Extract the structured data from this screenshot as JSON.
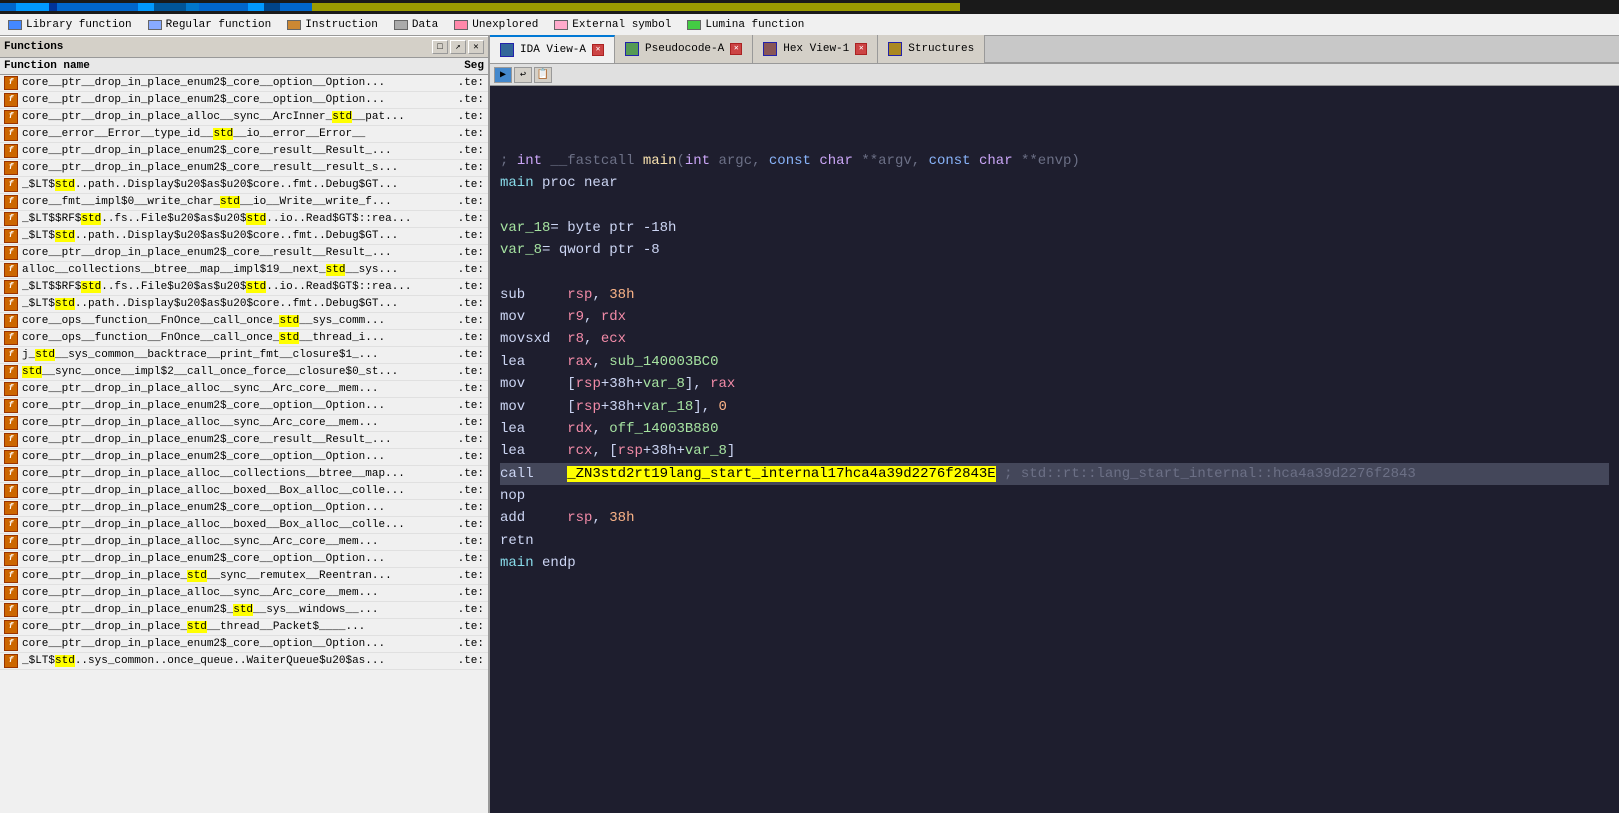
{
  "topbar": {
    "segments": [
      {
        "color": "#0078d4",
        "width": "3%"
      },
      {
        "color": "#00aaff",
        "width": "8%"
      },
      {
        "color": "#0055cc",
        "width": "2%"
      },
      {
        "color": "#0078d4",
        "width": "1%"
      },
      {
        "color": "#00aaff",
        "width": "5%"
      },
      {
        "color": "#0055cc",
        "width": "1%"
      },
      {
        "color": "#0078d4",
        "width": "3%"
      },
      {
        "color": "#1a1a1a",
        "width": "77%"
      }
    ]
  },
  "legend": {
    "items": [
      {
        "label": "Library function",
        "color": "#4488ff"
      },
      {
        "label": "Regular function",
        "color": "#88aaff"
      },
      {
        "label": "Instruction",
        "color": "#cc8833"
      },
      {
        "label": "Data",
        "color": "#aaaaaa"
      },
      {
        "label": "Unexplored",
        "color": "#ff88aa"
      },
      {
        "label": "External symbol",
        "color": "#ffaacc"
      },
      {
        "label": "Lumina function",
        "color": "#44cc44"
      }
    ]
  },
  "functions_panel": {
    "title": "Functions",
    "columns": {
      "name": "Function name",
      "seg": "Seg"
    },
    "items": [
      {
        "name": "core__ptr__drop_in_place_enum2$_core__option__Option...",
        "seg": ".te:"
      },
      {
        "name": "core__ptr__drop_in_place_enum2$_core__option__Option...",
        "seg": ".te:"
      },
      {
        "name": "core__ptr__drop_in_place_alloc__sync__ArcInner_std__pat...",
        "seg": ".te:"
      },
      {
        "name": "core__error__Error__type_id__std__io__error__Error__",
        "seg": ".te:"
      },
      {
        "name": "core__ptr__drop_in_place_enum2$_core__result__Result_...",
        "seg": ".te:"
      },
      {
        "name": "core__ptr__drop_in_place_enum2$_core__result__result_s...",
        "seg": ".te:"
      },
      {
        "name": "_$LT$std..path..Display$u20$as$u20$core..fmt..Debug$GT...",
        "seg": ".te:"
      },
      {
        "name": "core__fmt__impl$0__write_char_std__io__Write__write_f...",
        "seg": ".te:"
      },
      {
        "name": "_$LT$$RF$std..fs..File$u20$as$u20$std..io..Read$GT$::rea...",
        "seg": ".te:"
      },
      {
        "name": "_$LT$std..path..Display$u20$as$u20$core..fmt..Debug$GT...",
        "seg": ".te:"
      },
      {
        "name": "core__ptr__drop_in_place_enum2$_core__result__Result_...",
        "seg": ".te:"
      },
      {
        "name": "alloc__collections__btree__map__impl$19__next_std__sys...",
        "seg": ".te:"
      },
      {
        "name": "_$LT$$RF$std..fs..File$u20$as$u20$std..io..Read$GT$::rea...",
        "seg": ".te:"
      },
      {
        "name": "_$LT$std..path..Display$u20$as$u20$core..fmt..Debug$GT...",
        "seg": ".te:"
      },
      {
        "name": "core__ops__function__FnOnce__call_once_std__sys_comm...",
        "seg": ".te:"
      },
      {
        "name": "core__ops__function__FnOnce__call_once_std__thread_i...",
        "seg": ".te:"
      },
      {
        "name": "j_std__sys_common__backtrace__print_fmt__closure$1_...",
        "seg": ".te:"
      },
      {
        "name": "std__sync__once__impl$2__call_once_force__closure$0_st...",
        "seg": ".te:"
      },
      {
        "name": "core__ptr__drop_in_place_alloc__sync__Arc_core__mem...",
        "seg": ".te:"
      },
      {
        "name": "core__ptr__drop_in_place_enum2$_core__option__Option...",
        "seg": ".te:"
      },
      {
        "name": "core__ptr__drop_in_place_alloc__sync__Arc_core__mem...",
        "seg": ".te:"
      },
      {
        "name": "core__ptr__drop_in_place_enum2$_core__result__Result_...",
        "seg": ".te:"
      },
      {
        "name": "core__ptr__drop_in_place_enum2$_core__option__Option...",
        "seg": ".te:"
      },
      {
        "name": "core__ptr__drop_in_place_alloc__collections__btree__map...",
        "seg": ".te:"
      },
      {
        "name": "core__ptr__drop_in_place_alloc__boxed__Box_alloc__colle...",
        "seg": ".te:"
      },
      {
        "name": "core__ptr__drop_in_place_enum2$_core__option__Option...",
        "seg": ".te:"
      },
      {
        "name": "core__ptr__drop_in_place_alloc__boxed__Box_alloc__colle...",
        "seg": ".te:"
      },
      {
        "name": "core__ptr__drop_in_place_alloc__sync__Arc_core__mem...",
        "seg": ".te:"
      },
      {
        "name": "core__ptr__drop_in_place_enum2$_core__option__Option...",
        "seg": ".te:"
      },
      {
        "name": "core__ptr__drop_in_place_std__sync__remutex__Reentran...",
        "seg": ".te:"
      },
      {
        "name": "core__ptr__drop_in_place_alloc__sync__Arc_core__mem...",
        "seg": ".te:"
      },
      {
        "name": "core__ptr__drop_in_place_enum2$_std__sys__windows__...",
        "seg": ".te:"
      },
      {
        "name": "core__ptr__drop_in_place_std__thread__Packet$____...",
        "seg": ".te:"
      },
      {
        "name": "core__ptr__drop_in_place_enum2$_core__option__Option...",
        "seg": ".te:"
      },
      {
        "name": "_$LT$std..sys_common..once_queue..WaiterQueue$u20$as...",
        "seg": ".te:"
      }
    ]
  },
  "tabs": [
    {
      "label": "IDA View-A",
      "active": true,
      "closable": true
    },
    {
      "label": "Pseudocode-A",
      "active": false,
      "closable": true
    },
    {
      "label": "Hex View-1",
      "active": false,
      "closable": true
    },
    {
      "label": "Structures",
      "active": false,
      "closable": false
    }
  ],
  "code": {
    "comment_line": "; int __fastcall main(int argc, const char **argv, const char **envp)",
    "lines": [
      {
        "text": "",
        "type": "empty"
      },
      {
        "text": "",
        "type": "empty"
      },
      {
        "text": "; int __fastcall main(int argc, const char **argv, const char **envp)",
        "type": "comment"
      },
      {
        "text": "main proc near",
        "type": "label"
      },
      {
        "text": "",
        "type": "empty"
      },
      {
        "text": "var_18= byte ptr -18h",
        "type": "vardef"
      },
      {
        "text": "var_8= qword ptr -8",
        "type": "vardef"
      },
      {
        "text": "",
        "type": "empty"
      },
      {
        "text": "sub     rsp, 38h",
        "type": "instruction"
      },
      {
        "text": "mov     r9, rdx",
        "type": "instruction"
      },
      {
        "text": "movsxd  r8, ecx",
        "type": "instruction"
      },
      {
        "text": "lea     rax, sub_140003BC0",
        "type": "instruction"
      },
      {
        "text": "mov     [rsp+38h+var_8], rax",
        "type": "instruction"
      },
      {
        "text": "mov     [rsp+38h+var_18], 0",
        "type": "instruction"
      },
      {
        "text": "lea     rdx, off_14003B880",
        "type": "instruction"
      },
      {
        "text": "lea     rcx, [rsp+38h+var_8]",
        "type": "instruction"
      },
      {
        "text": "call    _ZN3std2rt19lang_start_internal17hca4a39d2276f2843E",
        "type": "call_highlighted"
      },
      {
        "text": "nop",
        "type": "instruction"
      },
      {
        "text": "add     rsp, 38h",
        "type": "instruction"
      },
      {
        "text": "retn",
        "type": "instruction"
      },
      {
        "text": "main endp",
        "type": "label"
      }
    ]
  }
}
